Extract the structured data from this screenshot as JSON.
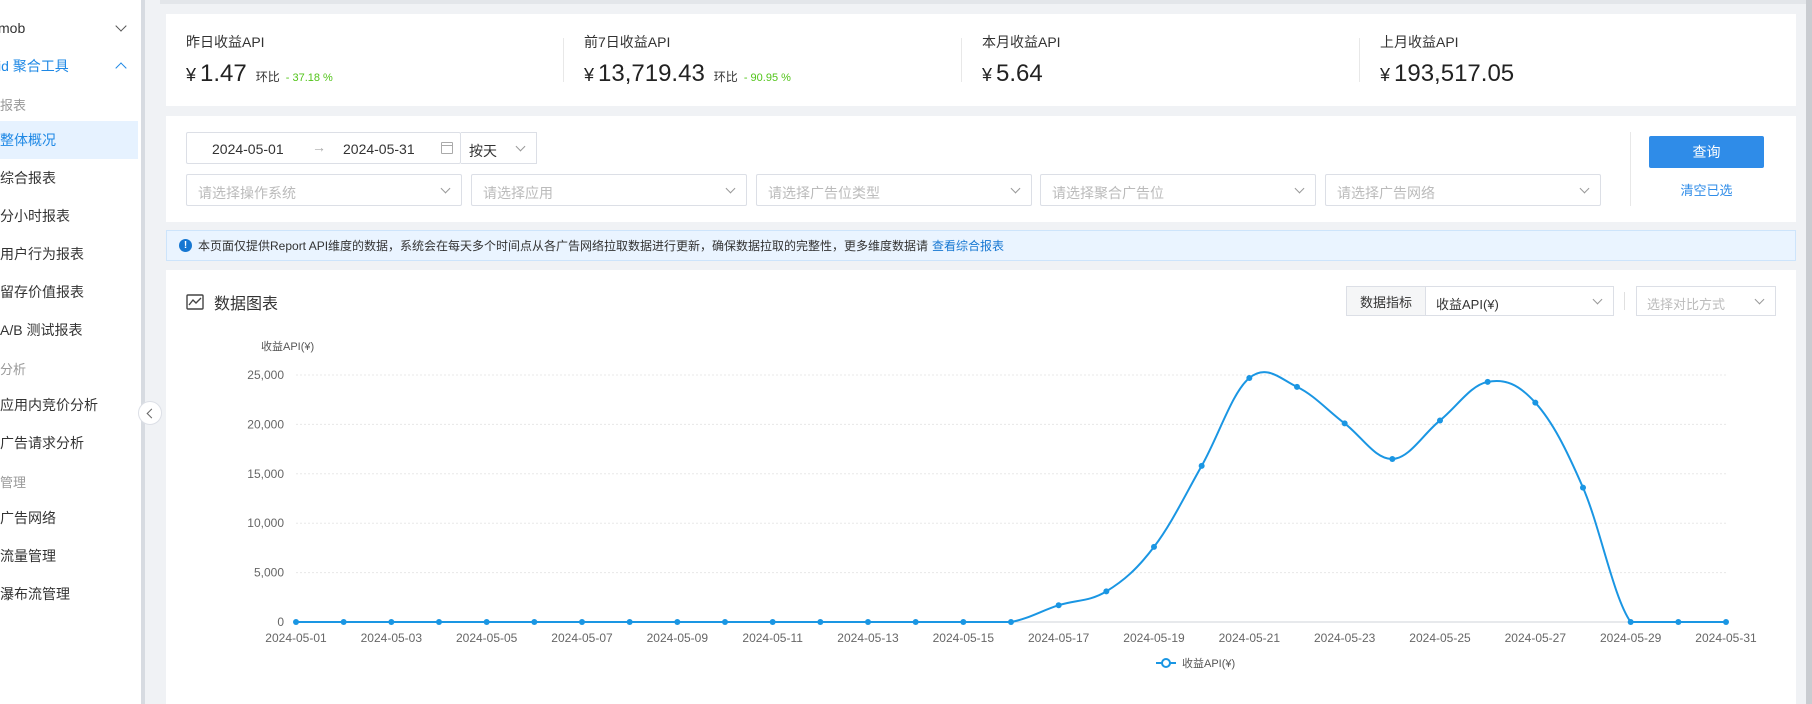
{
  "sidebar": {
    "items": [
      {
        "label": "mob",
        "type": "header"
      },
      {
        "label": "id 聚合工具",
        "type": "section"
      },
      {
        "label": "报表",
        "type": "group"
      },
      {
        "label": "整体概况",
        "type": "item",
        "selected": true
      },
      {
        "label": "综合报表",
        "type": "item"
      },
      {
        "label": "分小时报表",
        "type": "item"
      },
      {
        "label": "用户行为报表",
        "type": "item"
      },
      {
        "label": "留存价值报表",
        "type": "item"
      },
      {
        "label": "A/B 测试报表",
        "type": "item"
      },
      {
        "label": "分析",
        "type": "group"
      },
      {
        "label": "应用内竞价分析",
        "type": "item"
      },
      {
        "label": "广告请求分析",
        "type": "item"
      },
      {
        "label": "管理",
        "type": "group"
      },
      {
        "label": "广告网络",
        "type": "item"
      },
      {
        "label": "流量管理",
        "type": "item"
      },
      {
        "label": "瀑布流管理",
        "type": "item"
      }
    ]
  },
  "summary": [
    {
      "label": "昨日收益API",
      "currency": "¥",
      "value": "1.47",
      "cmp_label": "环比",
      "cmp_value": "- 37.18 %"
    },
    {
      "label": "前7日收益API",
      "currency": "¥",
      "value": "13,719.43",
      "cmp_label": "环比",
      "cmp_value": "- 90.95 %"
    },
    {
      "label": "本月收益API",
      "currency": "¥",
      "value": "5.64"
    },
    {
      "label": "上月收益API",
      "currency": "¥",
      "value": "193,517.05"
    }
  ],
  "filters": {
    "date_start": "2024-05-01",
    "date_end": "2024-05-31",
    "granularity": "按天",
    "os_placeholder": "请选择操作系统",
    "app_placeholder": "请选择应用",
    "adtype_placeholder": "请选择广告位类型",
    "mediation_placeholder": "请选择聚合广告位",
    "network_placeholder": "请选择广告网络",
    "query_label": "查询",
    "clear_label": "清空已选"
  },
  "notice": {
    "text": "本页面仅提供Report API维度的数据，系统会在每天多个时间点从各广告网络拉取数据进行更新，确保数据拉取的完整性，更多维度数据请",
    "link": "查看综合报表"
  },
  "chart_panel": {
    "title": "数据图表",
    "metric_label": "数据指标",
    "metric_value": "收益API(¥)",
    "compare_placeholder": "选择对比方式"
  },
  "colors": {
    "accent": "#2f8ce8",
    "line": "#1a96e3",
    "positive": "#52c41a"
  },
  "chart_data": {
    "type": "line",
    "ylabel": "收益API(¥)",
    "ylim": [
      0,
      25000
    ],
    "yticks": [
      0,
      5000,
      10000,
      15000,
      20000,
      25000
    ],
    "ytick_labels": [
      "0",
      "5,000",
      "10,000",
      "15,000",
      "20,000",
      "25,000"
    ],
    "x": [
      "2024-05-01",
      "2024-05-02",
      "2024-05-03",
      "2024-05-04",
      "2024-05-05",
      "2024-05-06",
      "2024-05-07",
      "2024-05-08",
      "2024-05-09",
      "2024-05-10",
      "2024-05-11",
      "2024-05-12",
      "2024-05-13",
      "2024-05-14",
      "2024-05-15",
      "2024-05-16",
      "2024-05-17",
      "2024-05-18",
      "2024-05-19",
      "2024-05-20",
      "2024-05-21",
      "2024-05-22",
      "2024-05-23",
      "2024-05-24",
      "2024-05-25",
      "2024-05-26",
      "2024-05-27",
      "2024-05-28",
      "2024-05-29",
      "2024-05-30",
      "2024-05-31"
    ],
    "xtick_labels": [
      "2024-05-01",
      "2024-05-03",
      "2024-05-05",
      "2024-05-07",
      "2024-05-09",
      "2024-05-11",
      "2024-05-13",
      "2024-05-15",
      "2024-05-17",
      "2024-05-19",
      "2024-05-21",
      "2024-05-23",
      "2024-05-25",
      "2024-05-27",
      "2024-05-29",
      "2024-05-31"
    ],
    "series": [
      {
        "name": "收益API(¥)",
        "values": [
          0,
          0,
          0,
          0,
          0,
          0,
          0,
          0,
          0,
          0,
          0,
          0,
          0,
          0,
          0,
          0,
          1700,
          3100,
          7600,
          15800,
          24700,
          23800,
          20100,
          16500,
          20400,
          24300,
          22200,
          13600,
          0,
          0,
          0
        ]
      }
    ],
    "grid": true,
    "legend": "bottom"
  }
}
